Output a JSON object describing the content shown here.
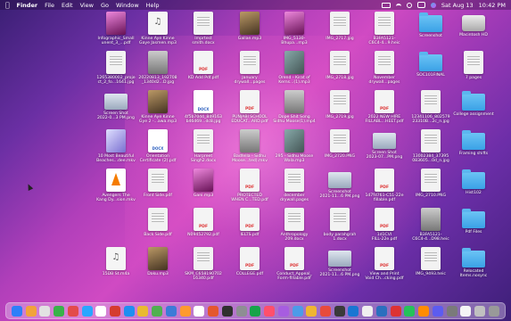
{
  "menubar": {
    "app": "Finder",
    "menus": [
      "File",
      "Edit",
      "View",
      "Go",
      "Window",
      "Help"
    ],
    "date": "Sat Aug 13",
    "time": "10:42 PM"
  },
  "desktop_items": [
    {
      "label": "Infographic_Small\nunent_3_...pdf",
      "kind": "img2"
    },
    {
      "label": "Kinne Aye Kinne\nGaye Jasmen.mp3",
      "kind": "audio"
    },
    {
      "label": "Imprtest\nsmith.docx",
      "kind": "doc"
    },
    {
      "label": "Gallan.mp3",
      "kind": "img3"
    },
    {
      "label": "IMG_5130-\nBhupa...mp3",
      "kind": "img2"
    },
    {
      "label": "IMG_2717.jpg",
      "kind": "doc"
    },
    {
      "label": "B3FA5121-\nC6C4-4...9.heic",
      "kind": "doc"
    },
    {
      "label": "Screenshot",
      "kind": "folder"
    },
    {
      "label": "Macintosh HD",
      "kind": "drive"
    },
    {
      "label": "1265380002_proje\nct_2_fo...1641.jpg",
      "kind": "doc"
    },
    {
      "label": "20220813_192708\n_1340d2...D.jpg",
      "kind": "photo"
    },
    {
      "label": "KD Add Pdf.pdf",
      "kind": "pdf"
    },
    {
      "label": "January\ndrywall...pages",
      "kind": "doc"
    },
    {
      "label": "Orend - Kirat of\nKerns...(1).mp3",
      "kind": "img"
    },
    {
      "label": "IMG_2718.jpg",
      "kind": "doc"
    },
    {
      "label": "November\ndrywall...pages",
      "kind": "doc"
    },
    {
      "label": "SOC101FINAL",
      "kind": "folder"
    },
    {
      "label": "7 pages",
      "kind": "doc"
    },
    {
      "label": "Screen Shot\n2022-0...3 PM.png",
      "kind": "shot"
    },
    {
      "label": "Kinne Aye Kinne\nGye 2 -...awa.mp3",
      "kind": "img3"
    },
    {
      "label": "4f5b70d4_849163\nb46d69...dc8.jpg",
      "kind": "word"
    },
    {
      "label": "PUNJABI SCHOOL\nEDUCAT...ARD.pdf",
      "kind": "pdf"
    },
    {
      "label": "Dope Shit Song\nSidhu Moose(1).mp4",
      "kind": "photo"
    },
    {
      "label": "IMG_2719.jpg",
      "kind": "doc"
    },
    {
      "label": "2022 NEW HIRE\nFILLABL...HEET.pdf",
      "kind": "pdf"
    },
    {
      "label": "12341106_802579\n23310B...2c_n.jpg",
      "kind": "doc"
    },
    {
      "label": "College assignment",
      "kind": "folder"
    },
    {
      "label": "10 Most Beautiful\nBeaches...dee.mkv",
      "kind": "video"
    },
    {
      "label": "Orientation\nCertificate (2).pdf",
      "kind": "word"
    },
    {
      "label": "Harpreet\nSingh2.docx",
      "kind": "doc"
    },
    {
      "label": "Badfella - Sidhu\nMoose...ted).mkv",
      "kind": "photo"
    },
    {
      "label": "295 - Sidhu Moose\nWala.mp3",
      "kind": "img"
    },
    {
      "label": "IMG_2720.PNG",
      "kind": "doc"
    },
    {
      "label": "Screen Shot\n2023-07...PM.png",
      "kind": "shot"
    },
    {
      "label": "13002384_37395\n083605...0d_n.jpg",
      "kind": "doc"
    },
    {
      "label": "Framing shifts",
      "kind": "folder"
    },
    {
      "label": "Avengers The\nKang Dy...sion.mkv",
      "kind": "vlc"
    },
    {
      "label": "Front Side.pdf",
      "kind": "doc"
    },
    {
      "label": "Gani.mp3",
      "kind": "img2"
    },
    {
      "label": "PROTECTED\nWHEN C...TED.pdf",
      "kind": "pdf"
    },
    {
      "label": "december\ndrywall.pages",
      "kind": "doc"
    },
    {
      "label": "Screenshot\n2021-11...6 PM.png",
      "kind": "shot"
    },
    {
      "label": "1d7fd761-C51-22e\nfillable.pdf",
      "kind": "pdf"
    },
    {
      "label": "IMG_2710.PNG",
      "kind": "doc"
    },
    {
      "label": "Hist102",
      "kind": "folder"
    },
    {
      "label": "Back Side.pdf",
      "kind": "doc"
    },
    {
      "label": "N09452792.pdf",
      "kind": "pdf"
    },
    {
      "label": "IELTS.pdf",
      "kind": "pdf"
    },
    {
      "label": "Anthropology\n209.docx",
      "kind": "doc"
    },
    {
      "label": "body parahgrah\n1.docx",
      "kind": "doc"
    },
    {
      "label": "1d1CVI\nFILL-22e.pdf",
      "kind": "pdf"
    },
    {
      "label": "B3FA5121-\nC6C4-4...D98.heic",
      "kind": "photo"
    },
    {
      "label": "Pdf Files",
      "kind": "folder"
    },
    {
      "label": "15DB St.m4a",
      "kind": "audio"
    },
    {
      "label": "Daku.mp3",
      "kind": "img3"
    },
    {
      "label": "SKM_C658190702\n16340.pdf",
      "kind": "doc"
    },
    {
      "label": "COLLEGE.pdf",
      "kind": "pdf"
    },
    {
      "label": "Conduct_Appeal_\nForm-fillable.pdf",
      "kind": "pdf"
    },
    {
      "label": "Screenshot\n2021-11...6 PM.png",
      "kind": "shot"
    },
    {
      "label": "View and Print\nVoid Ch...cking.pdf",
      "kind": "pdf"
    },
    {
      "label": "IMG_9493.heic",
      "kind": "doc"
    },
    {
      "label": "Relocated\nItems.nosync",
      "kind": "folder"
    }
  ],
  "dock_colors": [
    "#2d7ff9",
    "#f2a33a",
    "#e2e2e2",
    "#38b24a",
    "#e34b4b",
    "#29a6ff",
    "#ffffff",
    "#d53c2f",
    "#1f8ef1",
    "#e9ba2f",
    "#50b050",
    "#3c7bd7",
    "#ff9a2e",
    "#ffffff",
    "#e4572e",
    "#2f2f2f",
    "#8e8e93",
    "#17a34a",
    "#ff4f6c",
    "#a75de0",
    "#4c9be8",
    "#efb632",
    "#e84b3c",
    "#3a3a3a",
    "#1976d2",
    "#f0f0f0",
    "#2a6fbe",
    "#d33",
    "#25c25a",
    "#ff8c00",
    "#5c5cf0",
    "#7a7a7a",
    "#f5f5f5",
    "#c0c0c0",
    "#999999"
  ]
}
